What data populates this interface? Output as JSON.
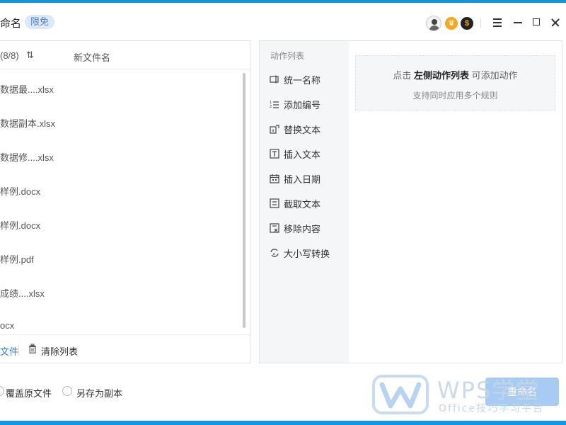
{
  "app": {
    "title": "命名",
    "badge": "限免"
  },
  "files": {
    "count_label": "(8/8)",
    "new_name_header": "新文件名",
    "items": [
      "数据最....xlsx",
      "数据副本.xlsx",
      "数据修....xlsx",
      "样例.docx",
      "样例.docx",
      "样例.pdf",
      "成绩....xlsx",
      "ocx"
    ],
    "add_file_label": "文件",
    "clear_list_label": "清除列表"
  },
  "actions": {
    "title": "动作列表",
    "items": [
      {
        "label": "统一名称",
        "icon": "rename-icon"
      },
      {
        "label": "添加编号",
        "icon": "numbered-list-icon"
      },
      {
        "label": "替换文本",
        "icon": "replace-text-icon"
      },
      {
        "label": "插入文本",
        "icon": "insert-text-icon"
      },
      {
        "label": "插入日期",
        "icon": "calendar-icon"
      },
      {
        "label": "截取文本",
        "icon": "cut-text-icon"
      },
      {
        "label": "移除内容",
        "icon": "remove-content-icon"
      },
      {
        "label": "大小写转换",
        "icon": "case-convert-icon"
      }
    ]
  },
  "hint": {
    "prefix": "点击 ",
    "emphasis": "左侧动作列表",
    "suffix": " 可添加动作",
    "sub": "支持同时应用多个规则"
  },
  "options": {
    "overwrite_label": "覆盖原文件",
    "save_copy_label": "另存为副本"
  },
  "rename_button": "重命名",
  "watermark": {
    "title": "WPS学堂",
    "subtitle": "Office技巧学习平台"
  },
  "colors": {
    "accent": "#1296db",
    "badge_bg": "#dde9fb",
    "badge_text": "#4b7fd4",
    "button_disabled": "#a7cbf3"
  }
}
